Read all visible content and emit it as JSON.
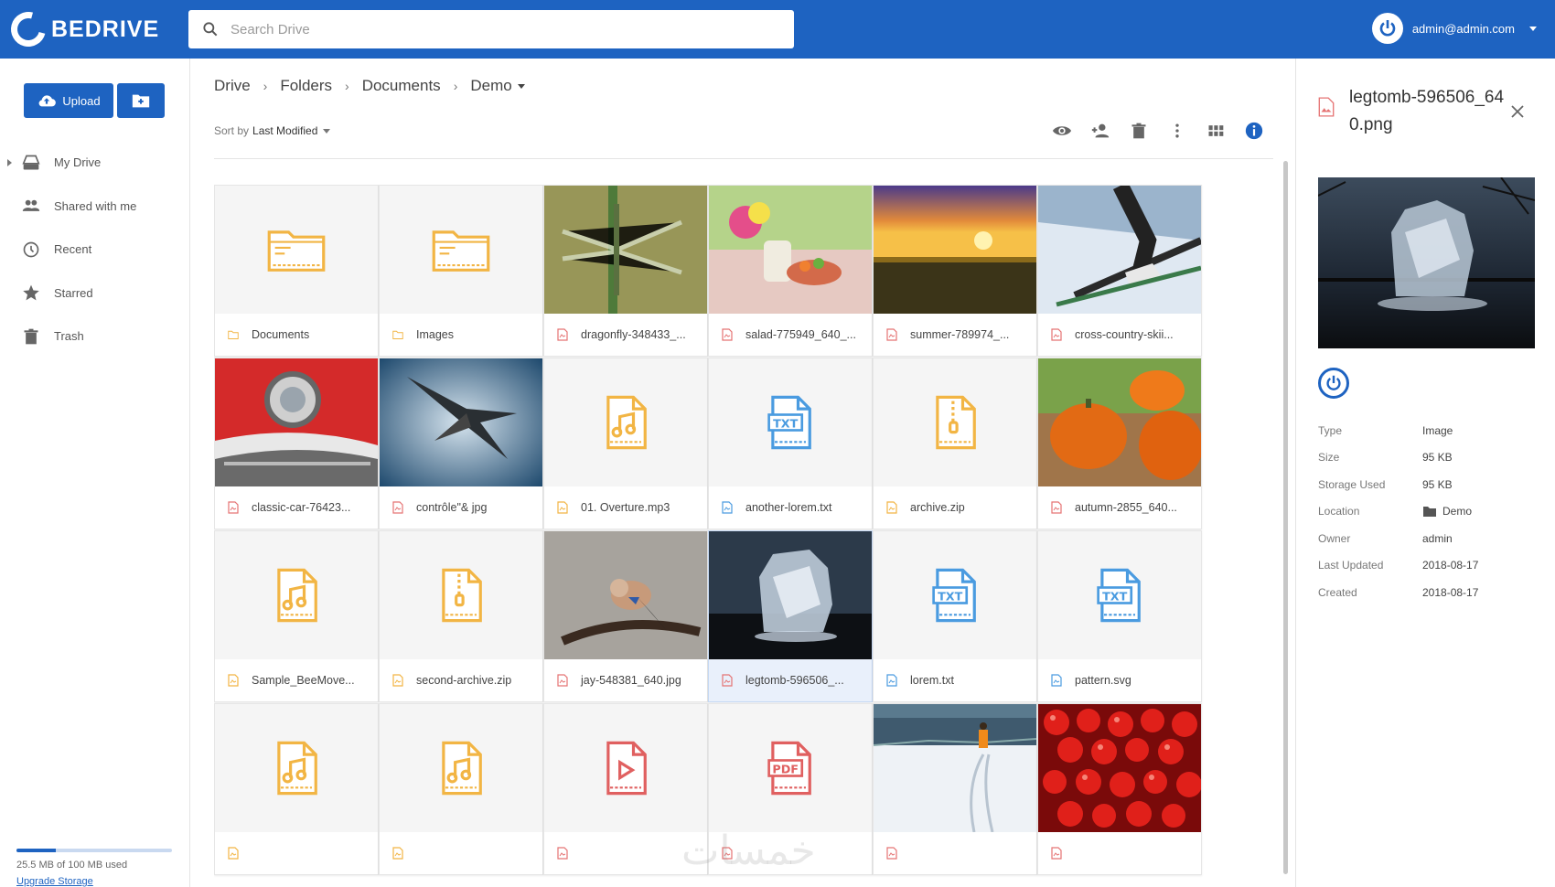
{
  "app": {
    "logo_text": "BEDRIVE",
    "brand_color": "#1e63c1"
  },
  "search": {
    "placeholder": "Search Drive",
    "value": ""
  },
  "user": {
    "email": "admin@admin.com"
  },
  "sidebar": {
    "upload_label": "Upload",
    "new_folder_icon": "folder-plus-icon",
    "items": [
      {
        "label": "My Drive",
        "icon": "drive-icon",
        "expandable": true
      },
      {
        "label": "Shared with me",
        "icon": "people-icon"
      },
      {
        "label": "Recent",
        "icon": "clock-icon"
      },
      {
        "label": "Starred",
        "icon": "star-icon"
      },
      {
        "label": "Trash",
        "icon": "trash-icon"
      }
    ],
    "storage": {
      "text": "25.5 MB of 100 MB used",
      "used_fraction": 0.255,
      "upgrade_label": "Upgrade Storage"
    }
  },
  "breadcrumb": [
    "Drive",
    "Folders",
    "Documents",
    "Demo"
  ],
  "sort": {
    "prefix": "Sort by",
    "value": "Last Modified"
  },
  "toolbar": {
    "icons": [
      "eye-icon",
      "share-icon",
      "trash-icon",
      "more-vert-icon",
      "grid-view-icon",
      "info-icon"
    ]
  },
  "files": [
    {
      "name": "Documents",
      "kind": "folder"
    },
    {
      "name": "Images",
      "kind": "folder"
    },
    {
      "name": "dragonfly-348433_...",
      "kind": "image",
      "scene": "dragonfly"
    },
    {
      "name": "salad-775949_640_...",
      "kind": "image",
      "scene": "salad"
    },
    {
      "name": "summer-789974_...",
      "kind": "image",
      "scene": "sunset"
    },
    {
      "name": "cross-country-skii...",
      "kind": "image",
      "scene": "ski"
    },
    {
      "name": "classic-car-76423...",
      "kind": "image",
      "scene": "car"
    },
    {
      "name": "contrôle\"& jpg",
      "kind": "image",
      "scene": "bird"
    },
    {
      "name": "01. Overture.mp3",
      "kind": "audio"
    },
    {
      "name": "another-lorem.txt",
      "kind": "text"
    },
    {
      "name": "archive.zip",
      "kind": "archive"
    },
    {
      "name": "autumn-2855_640...",
      "kind": "image",
      "scene": "pumpkins"
    },
    {
      "name": "Sample_BeeMove...",
      "kind": "audio"
    },
    {
      "name": "second-archive.zip",
      "kind": "archive"
    },
    {
      "name": "jay-548381_640.jpg",
      "kind": "image",
      "scene": "jay"
    },
    {
      "name": "legtomb-596506_...",
      "kind": "image",
      "scene": "ice",
      "selected": true
    },
    {
      "name": "lorem.txt",
      "kind": "text"
    },
    {
      "name": "pattern.svg",
      "kind": "text"
    },
    {
      "name": "",
      "kind": "audio"
    },
    {
      "name": "",
      "kind": "audio"
    },
    {
      "name": "",
      "kind": "video"
    },
    {
      "name": "",
      "kind": "pdf"
    },
    {
      "name": "",
      "kind": "image",
      "scene": "snowski"
    },
    {
      "name": "",
      "kind": "image",
      "scene": "berries"
    }
  ],
  "details": {
    "title": "legtomb-596506_640.png",
    "properties": [
      {
        "key": "Type",
        "value": "Image"
      },
      {
        "key": "Size",
        "value": "95 KB"
      },
      {
        "key": "Storage Used",
        "value": "95 KB"
      },
      {
        "key": "Location",
        "value": "Demo",
        "folder_icon": true
      },
      {
        "key": "Owner",
        "value": "admin"
      },
      {
        "key": "Last Updated",
        "value": "2018-08-17"
      },
      {
        "key": "Created",
        "value": "2018-08-17"
      }
    ]
  },
  "watermark": "خمسات"
}
